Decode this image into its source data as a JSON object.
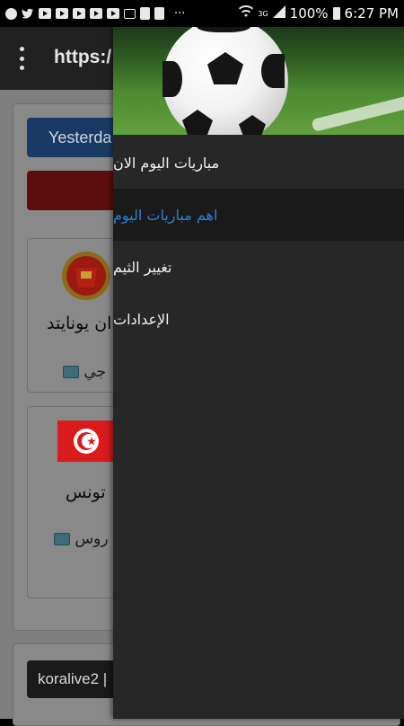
{
  "status_bar": {
    "battery": "100%",
    "time": "6:27 PM",
    "network": "3G",
    "more": "···"
  },
  "app_bar": {
    "url": "https:/"
  },
  "background": {
    "yesterday_button": "Yesterda",
    "match1": {
      "team": "ان يونايتد",
      "channel": "جي"
    },
    "match2": {
      "team": "تونس",
      "channel": "روس"
    },
    "footer_pill": "koralive2 |"
  },
  "drawer": {
    "items": [
      {
        "label": "مباريات اليوم الان",
        "active": false
      },
      {
        "label": "اهم مباريات اليوم",
        "active": true
      },
      {
        "label": "تغيير الثيم",
        "active": false
      },
      {
        "label": "الإعدادات",
        "active": false
      }
    ]
  },
  "colors": {
    "active_item": "#2f7fd0",
    "drawer_bg": "#272727",
    "app_bar": "#212121"
  }
}
